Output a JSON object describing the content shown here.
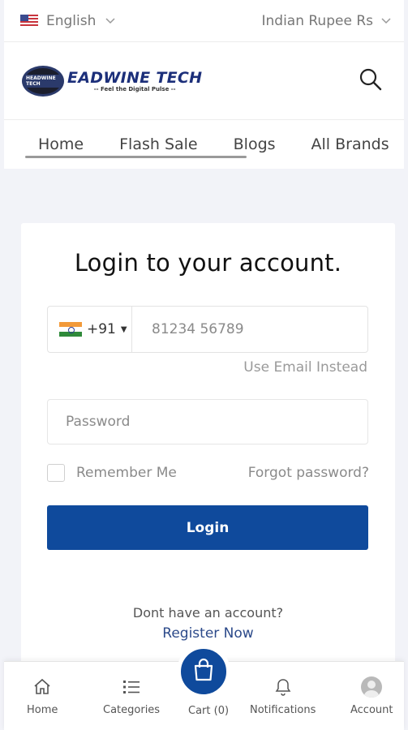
{
  "topbar": {
    "language": "English",
    "language_flag_icon": "us-flag-icon",
    "currency": "Indian Rupee Rs"
  },
  "header": {
    "logo_title": "EADWINE TECH",
    "logo_tagline": "-- Feel the Digital Pulse --",
    "logo_badge": "HEADWINE TECH",
    "search_icon": "search-icon"
  },
  "nav": {
    "items": [
      "Home",
      "Flash Sale",
      "Blogs",
      "All Brands"
    ]
  },
  "login": {
    "title": "Login to your account.",
    "country_code": "+91",
    "country_flag_icon": "india-flag-icon",
    "phone_placeholder": "81234 56789",
    "use_email_link": "Use Email Instead",
    "password_placeholder": "Password",
    "remember_label": "Remember Me",
    "forgot_link": "Forgot password?",
    "submit_label": "Login",
    "no_account_text": "Dont have an account?",
    "register_link": "Register Now"
  },
  "bottom_nav": {
    "home": "Home",
    "categories": "Categories",
    "cart": "Cart (0)",
    "notifications": "Notifications",
    "account": "Account"
  },
  "colors": {
    "primary": "#0f4a9c",
    "background": "#f2f3f8"
  }
}
